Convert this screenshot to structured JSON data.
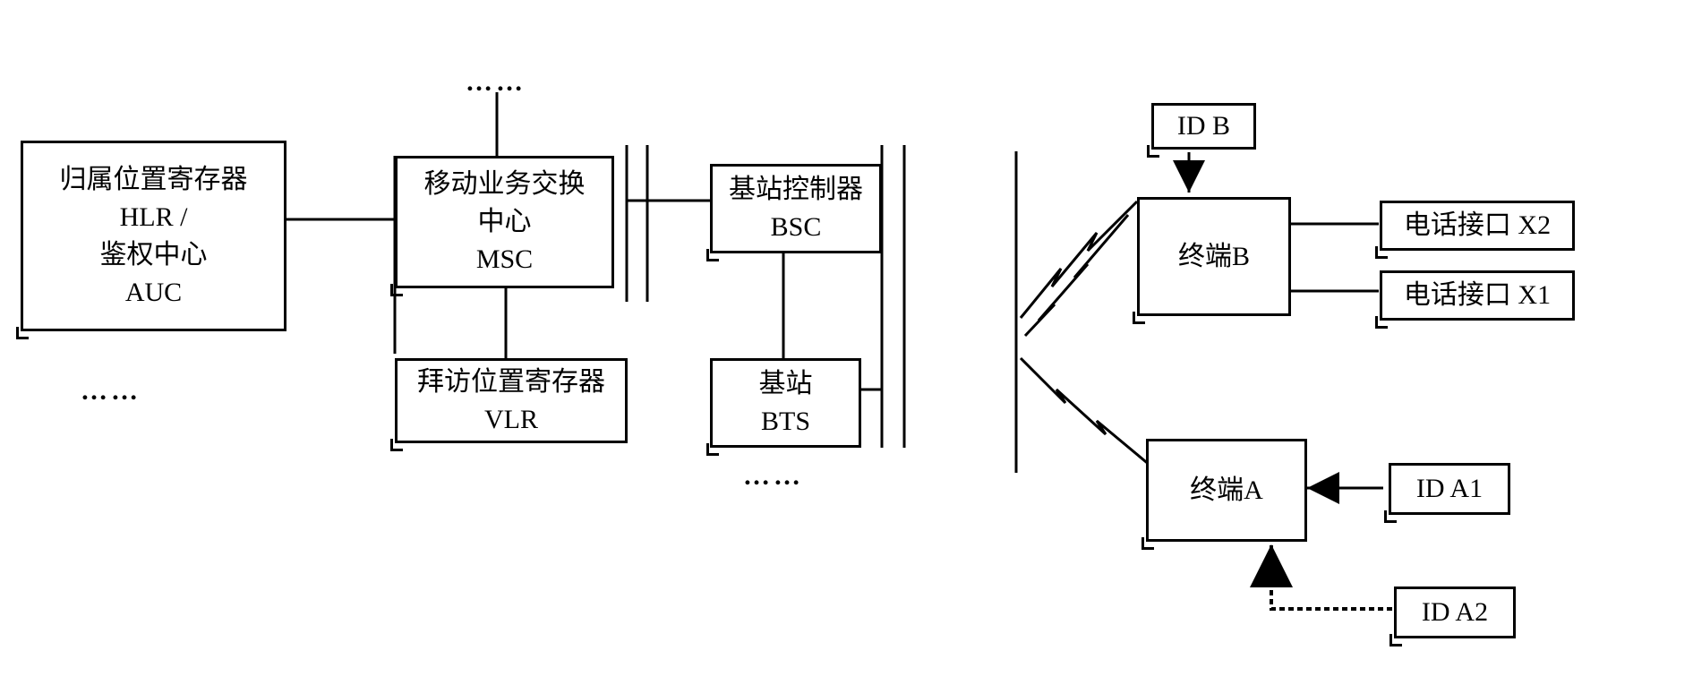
{
  "hlr": {
    "line1": "归属位置寄存器",
    "line2": "HLR  /",
    "line3": "鉴权中心",
    "line4": "AUC"
  },
  "msc": {
    "line1": "移动业务交换",
    "line2": "中心",
    "line3": "MSC"
  },
  "vlr": {
    "line1": "拜访位置寄存器",
    "line2": "VLR"
  },
  "bsc": {
    "line1": "基站控制器",
    "line2": "BSC"
  },
  "bts": {
    "line1": "基站",
    "line2": "BTS"
  },
  "idb": {
    "label": "ID B"
  },
  "terminalB": {
    "label": "终端B"
  },
  "terminalA": {
    "label": "终端A"
  },
  "phoneX2": {
    "label": "电话接口 X2"
  },
  "phoneX1": {
    "label": "电话接口 X1"
  },
  "ida1": {
    "label": "ID A1"
  },
  "ida2": {
    "label": "ID A2"
  },
  "ellipsis": "……"
}
